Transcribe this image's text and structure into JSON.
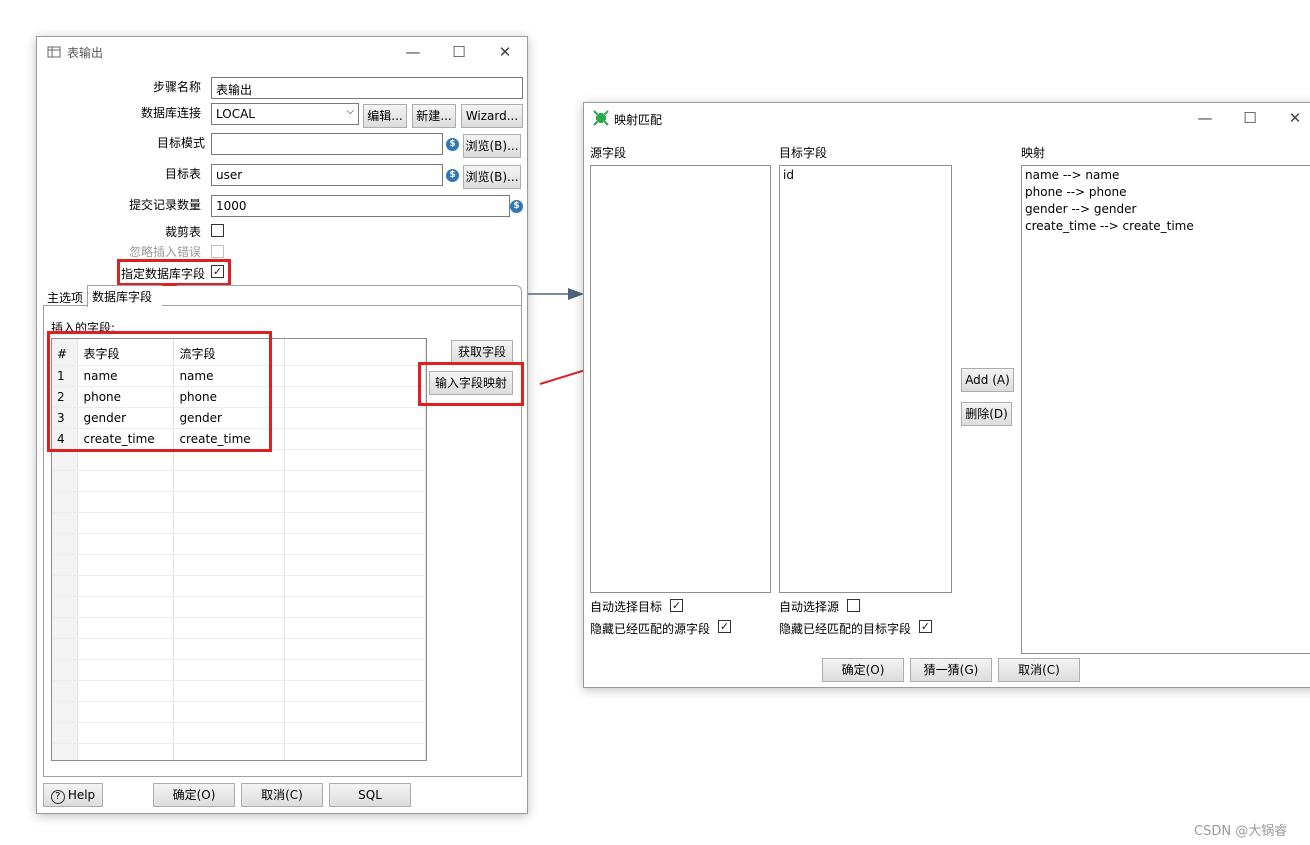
{
  "table_output": {
    "title": "表输出",
    "step_name_label": "步骤名称",
    "step_name_value": "表输出",
    "db_connection_label": "数据库连接",
    "db_connection_value": "LOCAL",
    "edit_button": "编辑...",
    "new_button": "新建...",
    "wizard_button": "Wizard...",
    "target_schema_label": "目标模式",
    "target_schema_value": "",
    "browse_schema_button": "浏览(B)...",
    "target_table_label": "目标表",
    "target_table_value": "user",
    "browse_table_button": "浏览(B)...",
    "commit_size_label": "提交记录数量",
    "commit_size_value": "1000",
    "truncate_label": "裁剪表",
    "ignore_errors_label": "忽略插入错误",
    "specify_fields_label": "指定数据库字段",
    "tabs": [
      "主选项",
      "数据库字段"
    ],
    "fields_group_label": "插入的字段:",
    "grid_headers": [
      "#",
      "表字段",
      "流字段"
    ],
    "grid_rows": [
      [
        "1",
        "name",
        "name"
      ],
      [
        "2",
        "phone",
        "phone"
      ],
      [
        "3",
        "gender",
        "gender"
      ],
      [
        "4",
        "create_time",
        "create_time"
      ]
    ],
    "get_fields_button": "获取字段",
    "map_fields_button": "输入字段映射",
    "help_button": "Help",
    "ok_button": "确定(O)",
    "cancel_button": "取消(C)",
    "sql_button": "SQL"
  },
  "mapping_dialog": {
    "title": "映射匹配",
    "source_label": "源字段",
    "target_label": "目标字段",
    "mapping_label": "映射",
    "source_items": [],
    "target_items": [
      "id"
    ],
    "mapping_items": [
      "name --> name",
      "phone --> phone",
      "gender --> gender",
      "create_time --> create_time"
    ],
    "add_button": "Add (A)",
    "delete_button": "删除(D)",
    "auto_target_label": "自动选择目标",
    "hide_source_label": "隐藏已经匹配的源字段",
    "auto_source_label": "自动选择源",
    "hide_target_label": "隐藏已经匹配的目标字段",
    "ok_button": "确定(O)",
    "guess_button": "猜一猜(G)",
    "cancel_button": "取消(C)"
  },
  "watermark": "CSDN @大锅睿",
  "colors": {
    "highlight_red": "#e02020",
    "icon_blue": "#2f77b5",
    "mapping_icon_green": "#2aa84a"
  }
}
